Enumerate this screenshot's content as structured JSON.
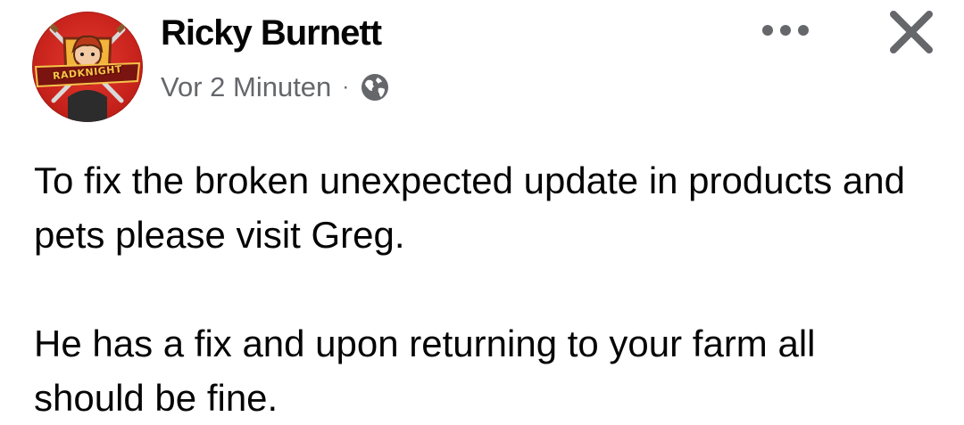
{
  "post": {
    "author": "Ricky Burnett",
    "avatar_logo_text": "RADKNIGHT",
    "timestamp": "Vor 2 Minuten",
    "separator": "·",
    "audience_icon": "globe-icon",
    "more_icon": "more-options-icon",
    "close_icon": "close-icon",
    "paragraphs": [
      "To fix the broken unexpected update in products and pets please visit Greg.",
      "He has a fix and upon returning to your farm all should be fine."
    ]
  },
  "colors": {
    "text_primary": "#050505",
    "text_secondary": "#65676b",
    "icon": "#65676b",
    "avatar_red": "#c8231c"
  }
}
